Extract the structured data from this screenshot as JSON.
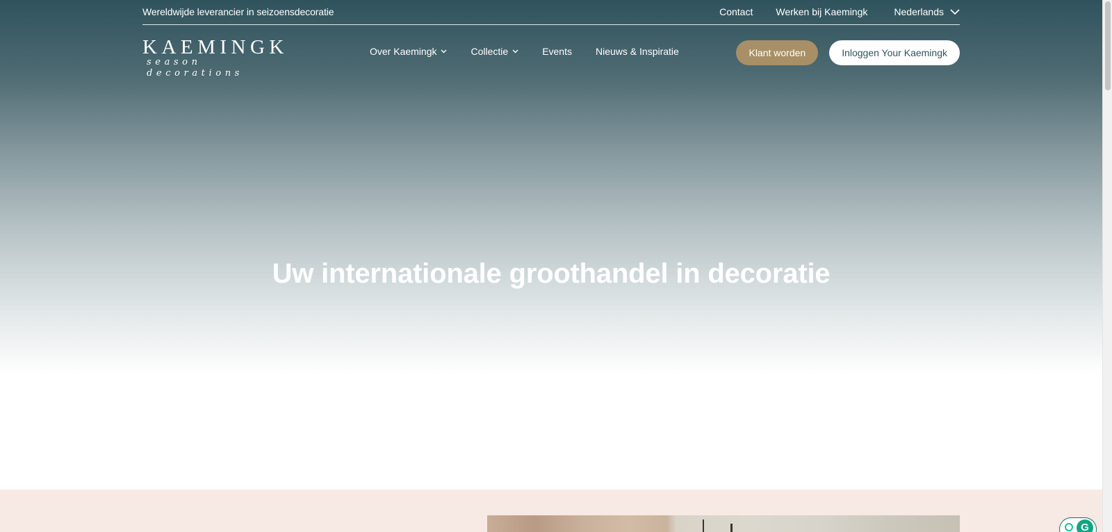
{
  "topbar": {
    "tagline": "Wereldwijde leverancier in seizoensdecoratie",
    "links": [
      "Contact",
      "Werken bij Kaemingk"
    ],
    "language": "Nederlands",
    "language_icon": "chevron-down-icon"
  },
  "logo": {
    "main": "KAEMINGK",
    "sub": "season decorations"
  },
  "nav": {
    "items": [
      {
        "label": "Over Kaemingk",
        "has_dropdown": true
      },
      {
        "label": "Collectie",
        "has_dropdown": true
      },
      {
        "label": "Events",
        "has_dropdown": false
      },
      {
        "label": "Nieuws & Inspiratie",
        "has_dropdown": false
      }
    ],
    "klant_button": "Klant worden",
    "login_button": "Inloggen Your Kaemingk"
  },
  "hero": {
    "title": "Uw internationale groothandel in decoratie"
  },
  "colors": {
    "brand_dark": "#2f535d",
    "accent_gold": "#a88f66",
    "section_bg": "#f7e9e3"
  },
  "widgets": {
    "grammarly_letter": "G"
  }
}
